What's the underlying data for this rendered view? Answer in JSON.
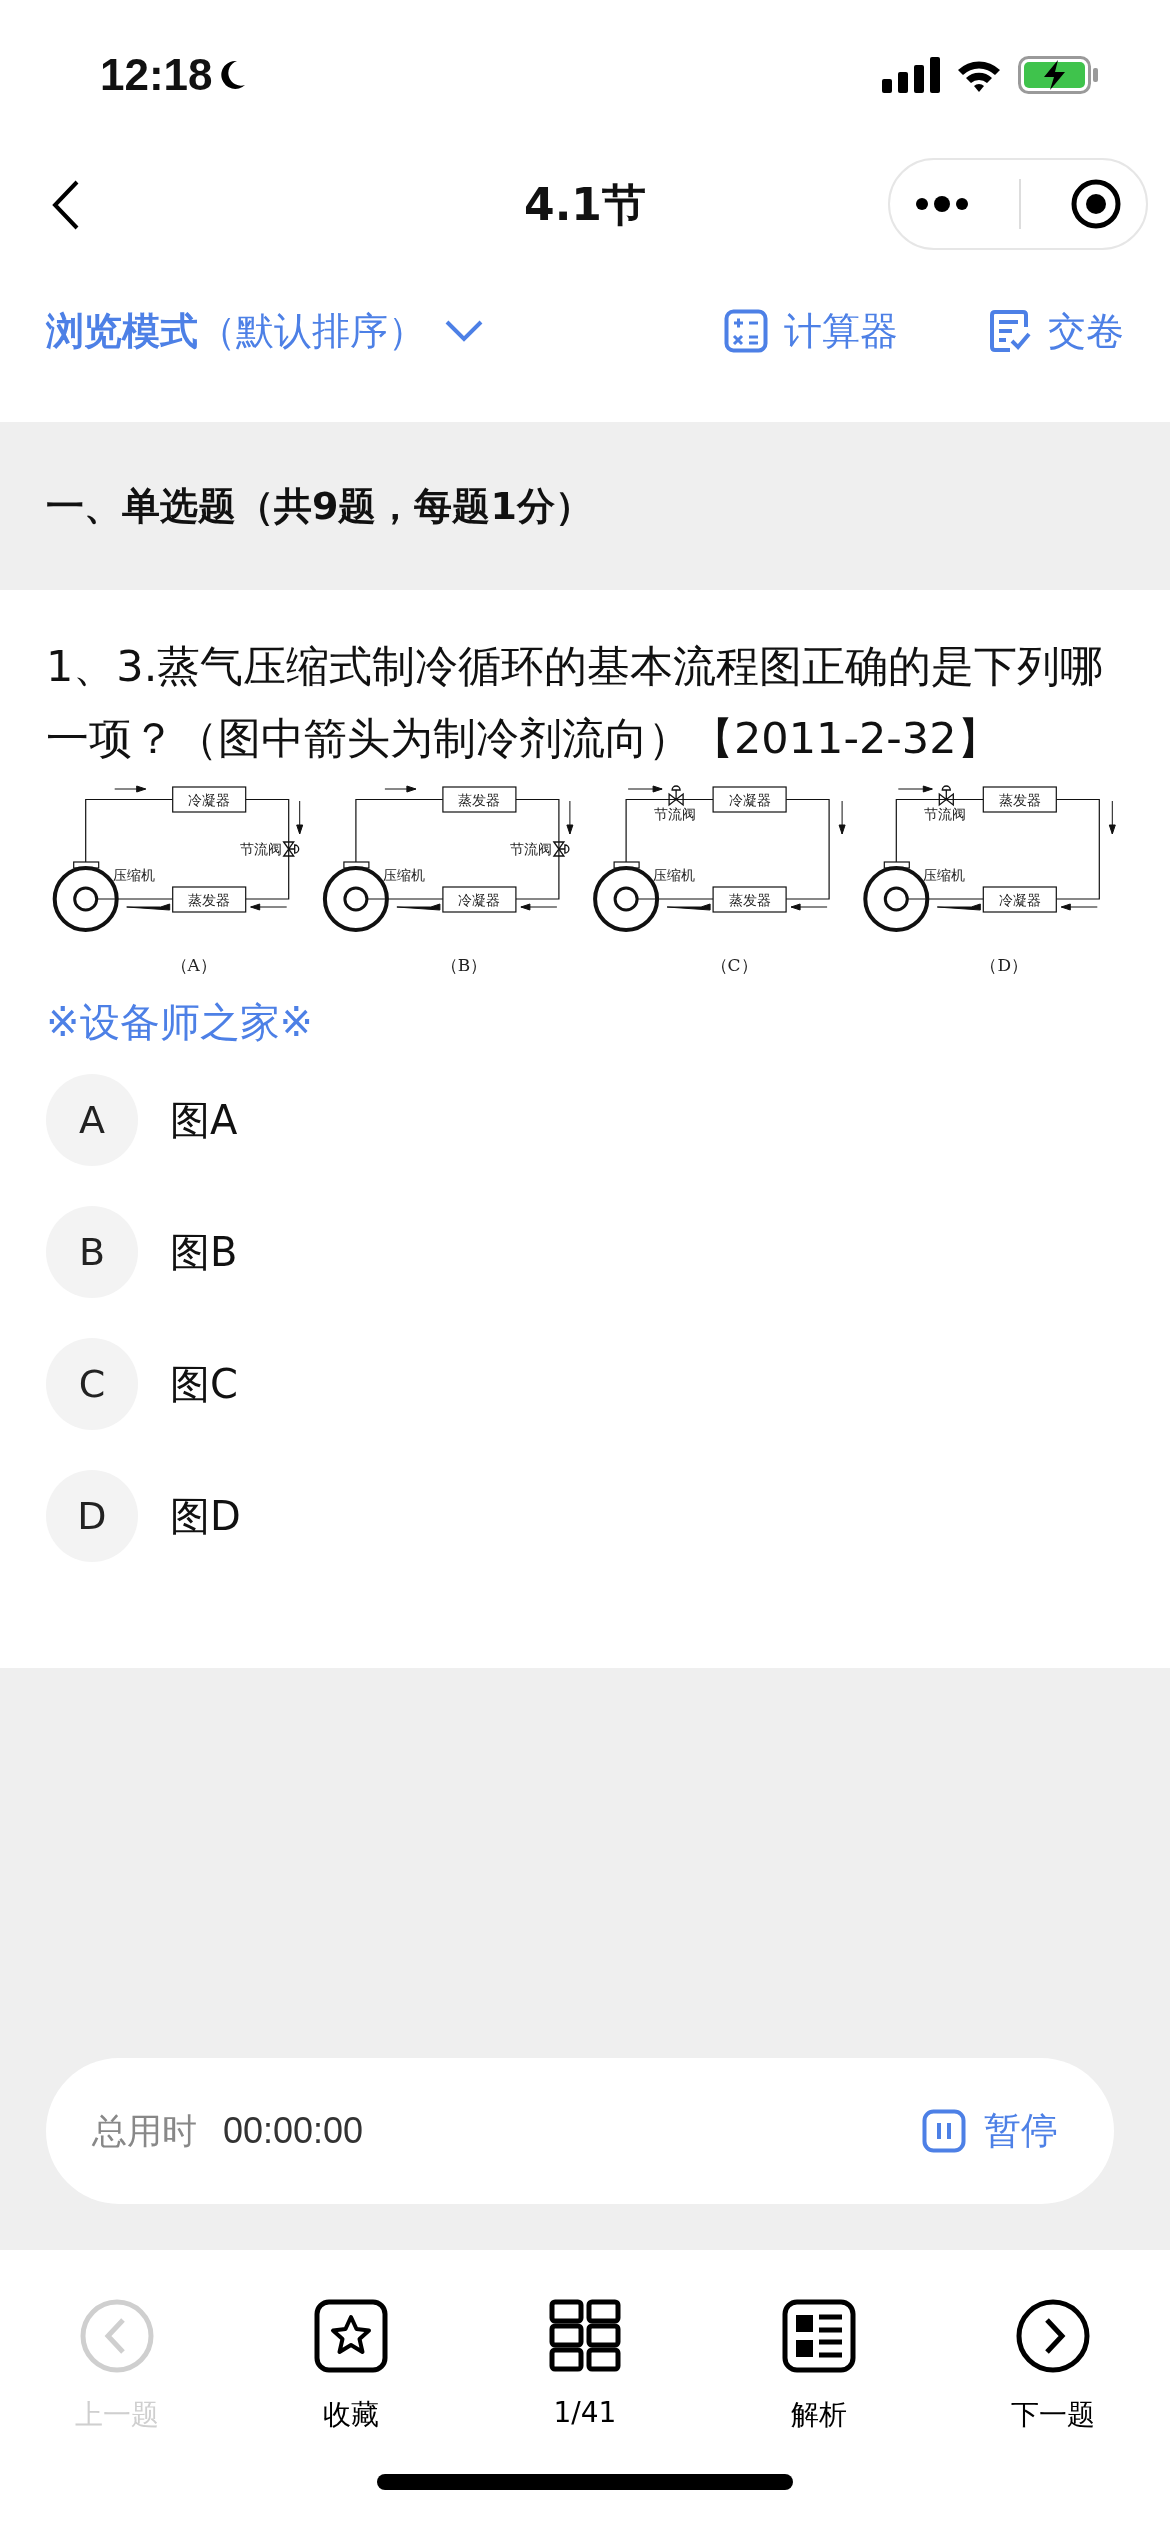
{
  "status_bar": {
    "time": "12:18"
  },
  "nav": {
    "title": "4.1节"
  },
  "mode_bar": {
    "mode": "浏览模式",
    "sort": "（默认排序）",
    "tools": [
      {
        "label": "计算器",
        "kind": "calculator"
      },
      {
        "label": "交卷",
        "kind": "submit"
      }
    ]
  },
  "section": {
    "title": "一、单选题（共9题，每题1分）"
  },
  "question": {
    "text": "1、3.蒸气压缩式制冷循环的基本流程图正确的是下列哪一项？（图中箭头为制冷剂流向）【2011-2-32】",
    "figure": {
      "panels": [
        {
          "caption": "（A）",
          "upper": "冷凝器",
          "lower": "蒸发器",
          "valve": "节流阀",
          "kind": "side",
          "compressor": "压缩机"
        },
        {
          "caption": "（B）",
          "upper": "蒸发器",
          "lower": "冷凝器",
          "valve": "节流阀",
          "kind": "side",
          "compressor": "压缩机"
        },
        {
          "caption": "（C）",
          "upper": "冷凝器",
          "lower": "蒸发器",
          "valve": "节流阀",
          "kind": "top",
          "compressor": "压缩机"
        },
        {
          "caption": "（D）",
          "upper": "蒸发器",
          "lower": "冷凝器",
          "valve": "节流阀",
          "kind": "top",
          "compressor": "压缩机"
        }
      ]
    },
    "source_note": "※设备师之家※"
  },
  "options": [
    {
      "letter": "A",
      "text": "图A",
      "selected": false
    },
    {
      "letter": "B",
      "text": "图B",
      "selected": false
    },
    {
      "letter": "C",
      "text": "图C",
      "selected": false
    },
    {
      "letter": "D",
      "text": "图D",
      "selected": false
    }
  ],
  "timer": {
    "label": "总用时",
    "time": "00:00:00",
    "action": "暂停"
  },
  "bottom_nav": [
    {
      "label": "上一题",
      "kind": "prev",
      "disabled": true
    },
    {
      "label": "收藏",
      "kind": "favorite",
      "disabled": false
    },
    {
      "label": "1/41",
      "kind": "grid",
      "disabled": false
    },
    {
      "label": "解析",
      "kind": "analysis",
      "disabled": false
    },
    {
      "label": "下一题",
      "kind": "next",
      "disabled": false
    }
  ]
}
